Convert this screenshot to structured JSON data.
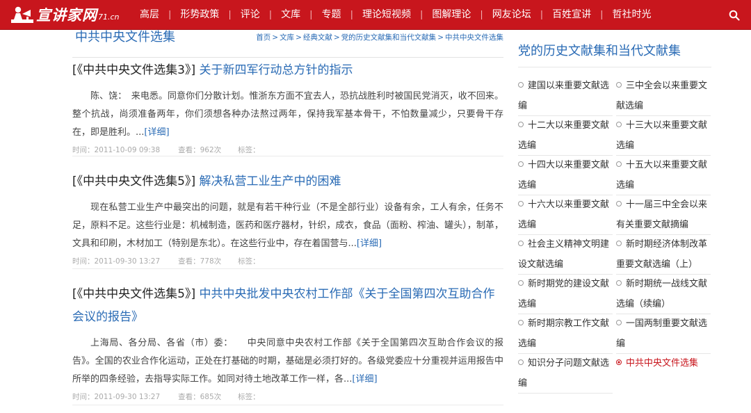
{
  "logo": {
    "text": "宣讲家网",
    "sub": "71.cn"
  },
  "nav": [
    "高层",
    "形势政策",
    "评论",
    "文库",
    "专题",
    "理论短视频",
    "图解理论",
    "网友论坛",
    "百姓宣讲",
    "哲社时光"
  ],
  "page_title": "中共中央文件选集",
  "breadcrumb": [
    "首页",
    "文库",
    "经典文献",
    "党的历史文献集和当代文献集",
    "中共中央文件选集"
  ],
  "meta_labels": {
    "time": "时间：",
    "views": "查看：",
    "tags": "标签："
  },
  "articles": [
    {
      "collection": "中共中央文件选集3",
      "title": "关于新四军行动总方针的指示",
      "body": "陈、饶：　来电悉。同意你们分散计划。惟浙东方面不宜去人，恐抗战胜利时被国民党消灭，收不回来。整个抗战，尚须准备两年，你们须想各种办法熬过两年，保持我军基本骨干，不怕数量减少，只要骨干存在，即是胜利。...",
      "detail": "[详细]",
      "time": "2011-10-09 09:38",
      "views": "962次"
    },
    {
      "collection": "中共中央文件选集5",
      "title": "解决私营工业生产中的困难",
      "body": "现在私营工业生产中最突出的问题，就是有若干种行业（不是全部行业）设备有余，工人有余，任务不足，原料不足。这些行业是：机械制造，医药和医疗器材，针织，成衣，食品（面粉、榨油、罐头），制革，文具和印刷，木材加工（特别是东北）。在这些行业中，存在着国营与...",
      "detail": "[详细]",
      "time": "2011-09-30 13:27",
      "views": "778次"
    },
    {
      "collection": "中共中央文件选集5",
      "title": "中共中央批发中央农村工作部《关于全国第四次互助合作会议的报告》",
      "body": "上海局、各分局、各省（市）委：　　中央同意中央农村工作部《关于全国第四次互助合作会议的报告》。全国的农业合作化运动，正处在打基础的时期，基础是必须打好的。各级党委应十分重视并运用报告中所举的四条经验，去指导实际工作。如同对待土地改革工作一样，各...",
      "detail": "[详细]",
      "time": "2011-09-30 13:27",
      "views": "685次"
    }
  ],
  "sidebar": {
    "title": "党的历史文献集和当代文献集",
    "items": [
      "建国以来重要文献选编",
      "三中全会以来重要文献选编",
      "十二大以来重要文献选编",
      "十三大以来重要文献选编",
      "十四大以来重要文献选编",
      "十五大以来重要文献选编",
      "十六大以来重要文献选编",
      "十一届三中全会以来有关重要文献摘编",
      "社会主义精神文明建设文献选编",
      "新时期经济体制改革重要文献选编（上）",
      "新时期党的建设文献选编",
      "新时期统一战线文献选编（续编）",
      "新时期宗教工作文献选编",
      "一国两制重要文献选编",
      "知识分子问题文献选编",
      "中共中央文件选集"
    ],
    "active_index": 15
  },
  "colors": {
    "nav_bg": "#c8161d",
    "link": "#2a6bb5"
  }
}
